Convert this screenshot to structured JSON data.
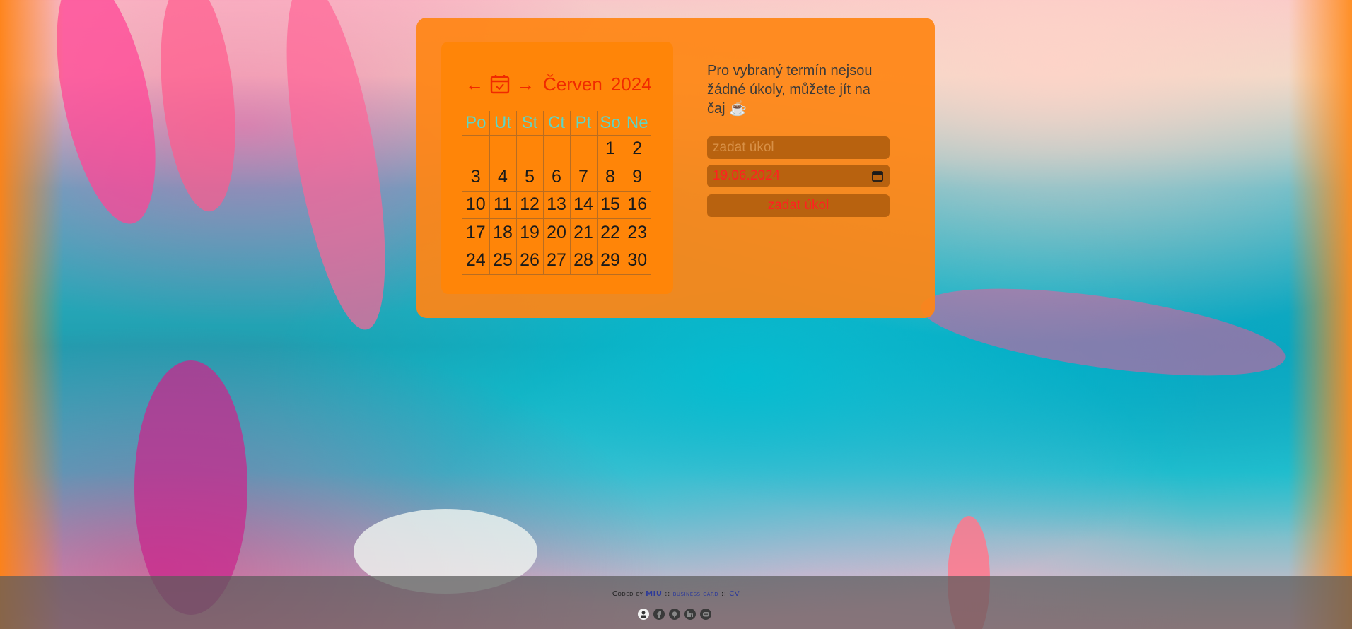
{
  "calendar": {
    "prev_arrow": "←",
    "next_arrow": "→",
    "month": "Červen",
    "year": "2024",
    "weekdays": [
      "Po",
      "Ut",
      "St",
      "Ct",
      "Pt",
      "So",
      "Ne"
    ],
    "weeks": [
      [
        "",
        "",
        "",
        "",
        "",
        "1",
        "2"
      ],
      [
        "3",
        "4",
        "5",
        "6",
        "7",
        "8",
        "9"
      ],
      [
        "10",
        "11",
        "12",
        "13",
        "14",
        "15",
        "16"
      ],
      [
        "17",
        "18",
        "19",
        "20",
        "21",
        "22",
        "23"
      ],
      [
        "24",
        "25",
        "26",
        "27",
        "28",
        "29",
        "30"
      ]
    ]
  },
  "tasks": {
    "empty_message": "Pro vybraný termín nejsou žádné úkoly, můžete jít na čaj ☕",
    "input_placeholder": "zadat úkol",
    "date_value": "19.06.2024",
    "submit_label": "zadat úkol"
  },
  "footer": {
    "coded_by": "Coded by",
    "author": "MIU",
    "sep1": "::",
    "business_card": "business card",
    "sep2": "::",
    "cv": "CV",
    "icons": [
      "avatar-icon",
      "facebook-icon",
      "github-icon",
      "linkedin-icon",
      "discord-icon"
    ]
  },
  "colors": {
    "panel": "#ff8514",
    "accent_red": "#f02a00",
    "weekday_teal": "#5fd5c5"
  }
}
